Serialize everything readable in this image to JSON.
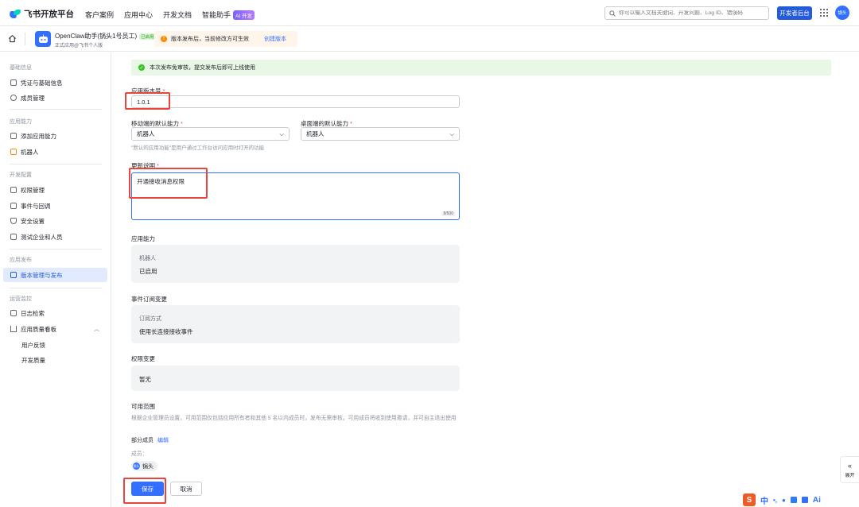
{
  "topbar": {
    "brand": "飞书开放平台",
    "nav": [
      "客户案例",
      "应用中心",
      "开发文档",
      "智能助手"
    ],
    "ai_badge": "AI 开发",
    "search_placeholder": "你可以输入文档关键词、开发问题、Log ID、错误码",
    "dev_console": "开发者后台",
    "avatar_text": "锅头"
  },
  "appbar": {
    "app_name": "OpenClaw助手(锅头1号员工)",
    "status_badge": "已启用",
    "app_sub": "正式应用@飞书个人版",
    "notice_text": "版本发布后，当前修改方可生效",
    "notice_link": "创建版本"
  },
  "sidebar": {
    "groups": {
      "basic": "基础信息",
      "capability": "应用能力",
      "dev": "开发配置",
      "publish": "应用发布",
      "ops": "运营监控"
    },
    "items": {
      "credentials": "凭证与基础信息",
      "members": "成员管理",
      "add_capability": "添加应用能力",
      "bot": "机器人",
      "permissions": "权限管理",
      "events": "事件与回调",
      "security": "安全设置",
      "test_enterprise": "测试企业和人员",
      "version_manage": "版本管理与发布",
      "logs": "日志检索",
      "quality": "应用质量看板",
      "feedback": "用户反馈",
      "dev_quality": "开发质量"
    }
  },
  "main": {
    "success_text": "本次发布免审核，提交发布后即可上线使用",
    "version_label": "应用版本号",
    "version_value": "1.0.1",
    "mobile_label": "移动端的默认能力",
    "mobile_value": "机器人",
    "desktop_label": "桌面端的默认能力",
    "desktop_value": "机器人",
    "default_hint": "\"默认的应用功能\"是用户通过工作台访问应用时打开的功能",
    "notes_label": "更新说明",
    "notes_value": "开通接收消息权限",
    "notes_counter": "8/500",
    "capability_title": "应用能力",
    "capability_name": "机器人",
    "capability_status": "已启用",
    "event_title": "事件订阅变更",
    "event_key": "订阅方式",
    "event_value": "使用长连接接收事件",
    "perm_title": "权限变更",
    "perm_value": "暂无",
    "scope_title": "可用范围",
    "scope_desc": "根据企业管理员设置，可用范围仅包括应用所有者和其他 5 名以内成员时，发布无需审核。可用成员将收到使用邀请，并可自主退出使用",
    "scope_partial": "部分成员",
    "scope_edit": "编辑",
    "members_label": "成员：",
    "member_name": "锅头",
    "member_avatar": "锅头",
    "save": "保存",
    "cancel": "取消"
  },
  "float": {
    "expand": "展开"
  },
  "ime": {
    "s": "S",
    "zh": "中",
    "ai": "Ai"
  }
}
